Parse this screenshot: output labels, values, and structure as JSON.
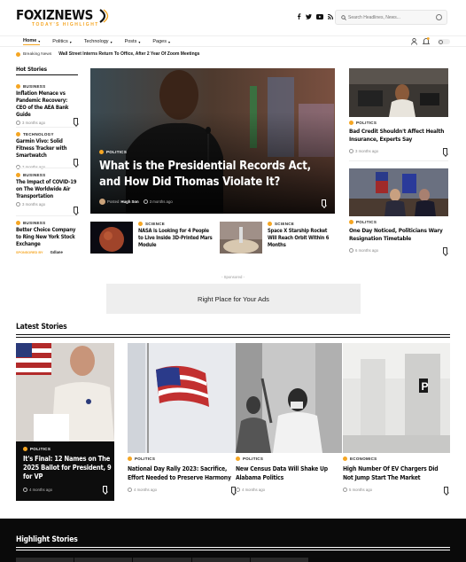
{
  "brand": {
    "logo_main": "FOXIZNEWS",
    "logo_tag": "TODAY'S HIGHLIGHT"
  },
  "header": {
    "search_placeholder": "Search Headlines, News...",
    "social_icons": [
      "facebook-icon",
      "twitter-icon",
      "youtube-icon",
      "rss-icon"
    ]
  },
  "nav": {
    "items": [
      "Home",
      "Politics",
      "Technology",
      "Posts",
      "Pages"
    ]
  },
  "ticker": {
    "label": "Breaking News",
    "headline": "Wall Street Interns Return To Office, After 2 Year Of Zoom Meetings"
  },
  "hot_stories": {
    "heading": "Hot Stories",
    "items": [
      {
        "category": "BUSINESS",
        "title": "Inflation Menace vs Pandemic Recovery: CEO of the AEA Bank Guide",
        "time": "3 months ago"
      },
      {
        "category": "TECHNOLOGY",
        "title": "Garmin Vivo: Solid Fitness Tracker with Smartwatch",
        "time": "7 months ago"
      },
      {
        "category": "BUSINESS",
        "title": "The Impact of COVID-19 on The Worldwide Air Transportation",
        "time": "3 months ago"
      },
      {
        "category": "BUSINESS",
        "title": "Better Choice Company to Ring New York Stock Exchange",
        "time": "",
        "sponsored": "SPONSORED BY",
        "sponsor_logo": "Gdlane"
      }
    ]
  },
  "featured": {
    "category": "POLITICS",
    "title": "What is the Presidential Records Act, and How Did Thomas Violate It?",
    "posted_by": "Posted",
    "author": "Hugh Son",
    "time": "3 months ago"
  },
  "sub_featured": [
    {
      "category": "SCIENCE",
      "title": "NASA is Looking for 4 People to Live Inside 3D-Printed Mars Module"
    },
    {
      "category": "SCIENCE",
      "title": "Space X Starship Rocket Will Reach Orbit Within 6 Months"
    }
  ],
  "right_col": [
    {
      "category": "POLITICS",
      "title": "Bad Credit Shouldn't Affect Health Insurance, Experts Say",
      "time": "3 months ago"
    },
    {
      "category": "POLITICS",
      "title": "One Day Noticed, Politicians Wary Resignation Timetable",
      "time": "6 months ago"
    }
  ],
  "ad": {
    "label": "- Sponsored -",
    "text": "Right Place for Your Ads"
  },
  "latest": {
    "heading": "Latest Stories",
    "items": [
      {
        "category": "POLITICS",
        "title": "It's Final: 12 Names on The 2025 Ballot for President, 9 for VP",
        "time": "4 months ago"
      },
      {
        "category": "POLITICS",
        "title": "National Day Rally 2023: Sacrifice, Effort Needed to Preserve Harmony",
        "time": "4 months ago"
      },
      {
        "category": "POLITICS",
        "title": "New Census Data Will Shake Up Alabama Politics",
        "time": "4 months ago"
      },
      {
        "category": "ECONOMICS",
        "title": "High Number Of EV Chargers Did Not Jump Start The Market",
        "time": "5 months ago"
      }
    ]
  },
  "highlight": {
    "heading": "Highlight Stories"
  }
}
